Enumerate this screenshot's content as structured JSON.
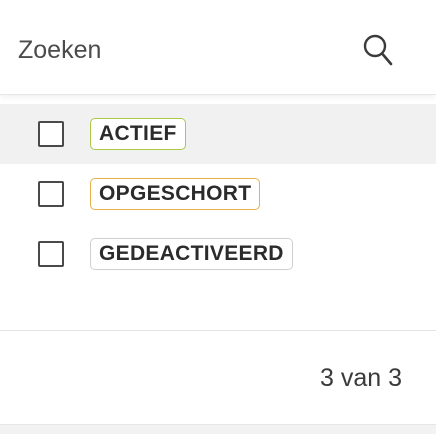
{
  "search": {
    "placeholder": "Zoeken",
    "icon": "search-icon"
  },
  "statuses": [
    {
      "label": "ACTIEF",
      "border_color": "#a9c94a",
      "checked": false,
      "selected": true
    },
    {
      "label": "OPGESCHORT",
      "border_color": "#e3b24f",
      "checked": false,
      "selected": false
    },
    {
      "label": "GEDEACTIVEERD",
      "border_color": "#cfcfcf",
      "checked": false,
      "selected": false
    }
  ],
  "footer": {
    "count_text": "3 van 3"
  }
}
